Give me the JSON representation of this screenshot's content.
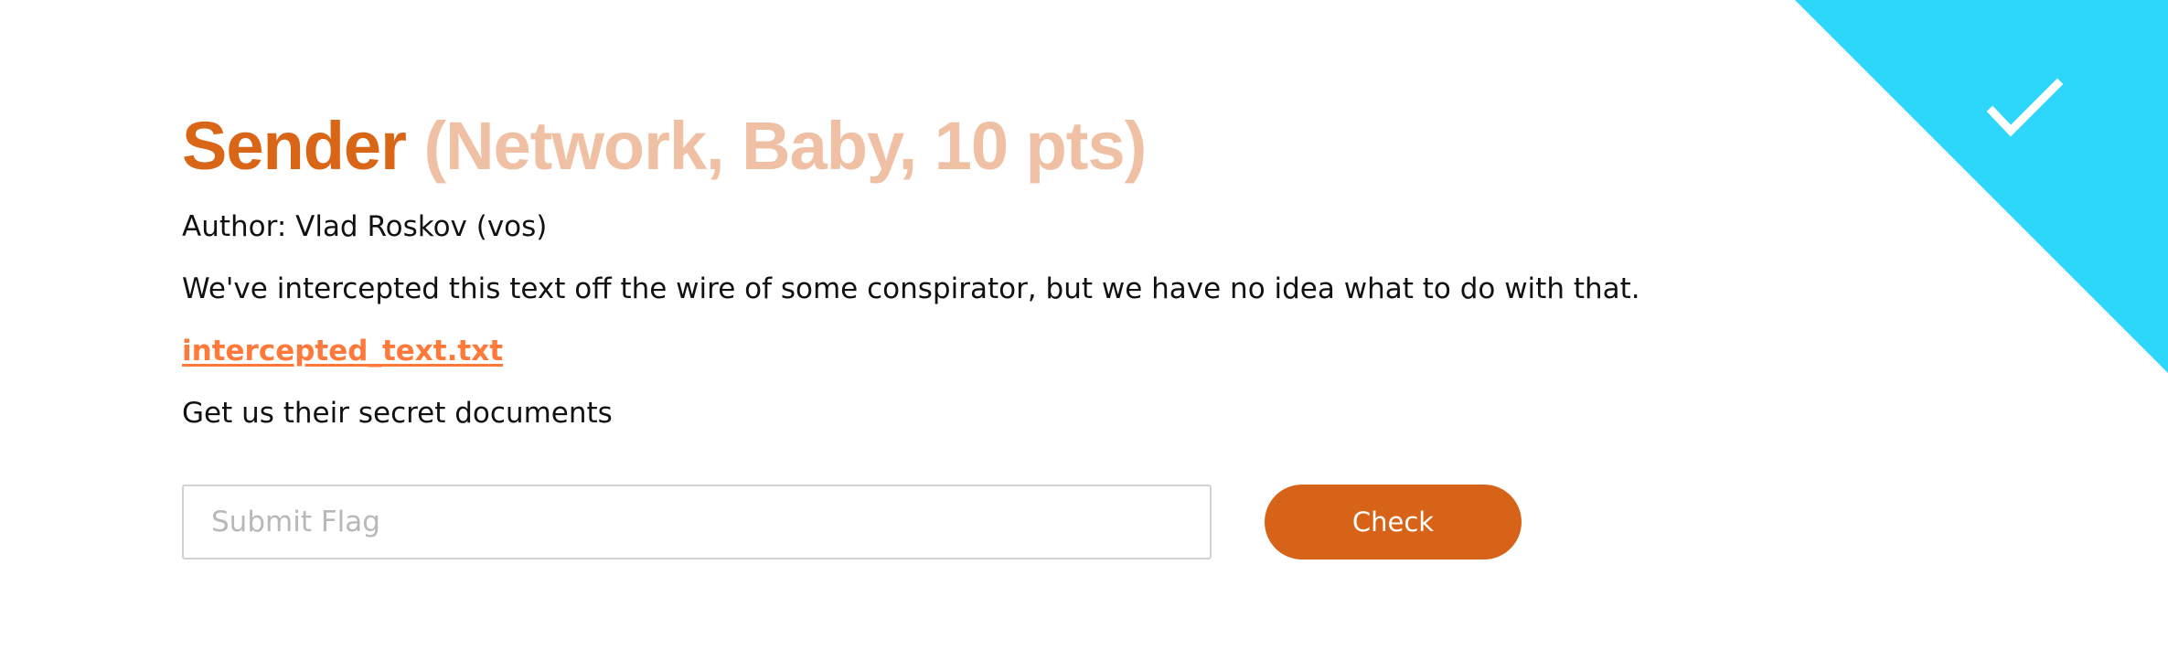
{
  "task": {
    "name": "Sender",
    "meta": "(Network, Baby, 10 pts)",
    "author": "Author: Vlad Roskov (vos)",
    "description": "We've intercepted this text off the wire of some conspirator, but we have no idea what to do with that.",
    "attachment": "intercepted_text.txt",
    "hint": "Get us their secret documents"
  },
  "flag_form": {
    "placeholder": "Submit Flag",
    "value": "",
    "check_label": "Check"
  },
  "status": {
    "icon": "checkmark-icon",
    "solved_color": "#2dd6fb"
  },
  "colors": {
    "accent": "#d96517",
    "meta": "#f0c0a4",
    "link": "#ff7a3a",
    "button": "#d66317"
  }
}
